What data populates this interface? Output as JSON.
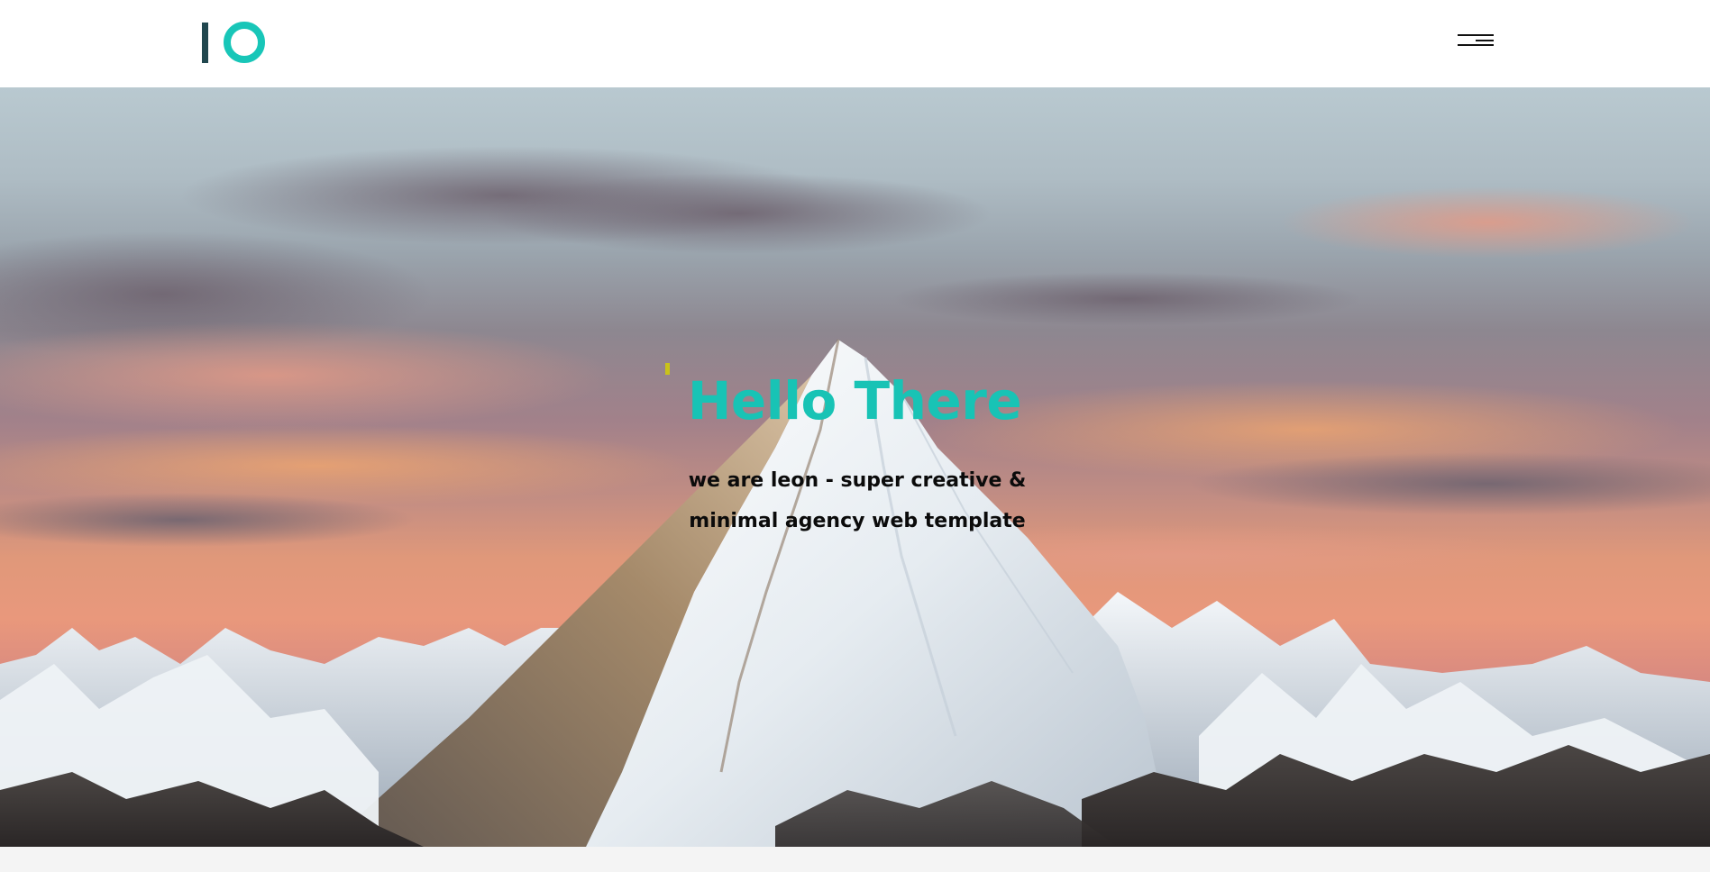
{
  "header": {
    "logo_label": "IO",
    "menu_icon": "hamburger-menu-icon"
  },
  "hero": {
    "title": "Hello There",
    "subtitle_line1": "we are leon - super creative &",
    "subtitle_line2": "minimal agency web template",
    "background_image": "snow-capped mountain peak at sunset"
  },
  "colors": {
    "brand_teal": "#18c6b8",
    "brand_dark": "#21474f",
    "accent_marker": "#c9c21a",
    "subtitle_text": "#0b0b0b",
    "header_bg": "#ffffff"
  }
}
